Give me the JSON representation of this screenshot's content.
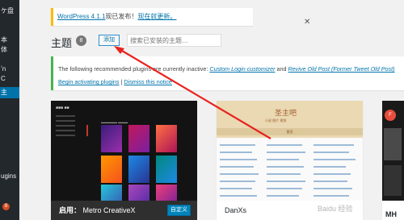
{
  "sidebar": {
    "items": [
      {
        "label": "ケ盘"
      },
      {
        "label": ""
      },
      {
        "label": "本"
      },
      {
        "label": "体"
      },
      {
        "label": ""
      },
      {
        "label": "ʼn"
      },
      {
        "label": "C"
      },
      {
        "label": ""
      },
      {
        "label": "主"
      },
      {
        "label": ""
      },
      {
        "label": "ugins"
      }
    ],
    "badge": "8"
  },
  "update_nag": {
    "link1": "WordPress 4.1.1",
    "text": "现已发布！",
    "link2": "现在就更新。"
  },
  "header": {
    "title": "主题",
    "count": "8",
    "add_label": "添加",
    "search_placeholder": "搜索已安装的主题…",
    "close_glyph": "✕"
  },
  "notice": {
    "lead": "The following recommended plugins are currently inactive:",
    "plugin1": "Custom Login customizer",
    "joiner": "and",
    "plugin2": "Revive Old Post (Former Tweet Old Post)",
    "begin_link": "Begin activating plugins",
    "separator": "|",
    "dismiss_link": "Dismiss this notice"
  },
  "themes": [
    {
      "prefix": "启用：",
      "name": "Metro CreativeX",
      "customize_label": "自定义",
      "active": true
    },
    {
      "name": "DanXs",
      "active": false
    },
    {
      "name": "MH",
      "active": false
    }
  ],
  "danxs_mock": {
    "logo": "圣主吧",
    "subtitle": "小说  图片  视频",
    "nav": "首页"
  },
  "mh_mock": {
    "logo": "F"
  },
  "watermark": "Baidu 经验"
}
